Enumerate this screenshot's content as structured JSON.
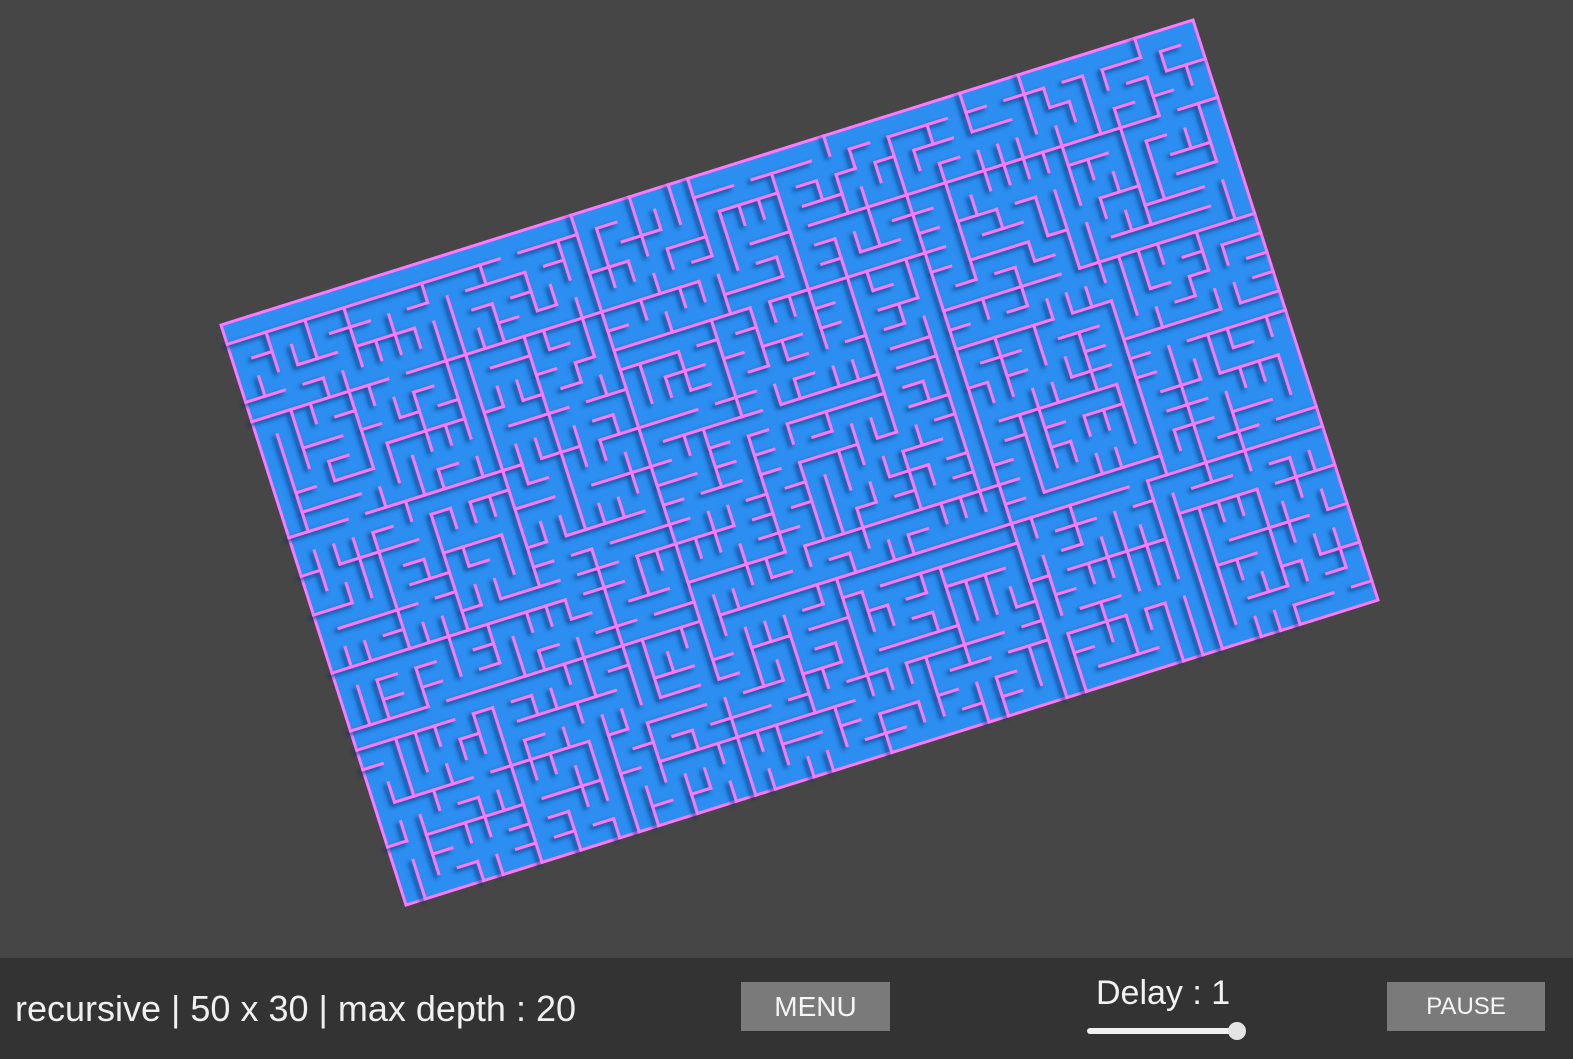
{
  "status": {
    "text": "recursive | 50 x 30 | max depth : 20",
    "algorithm": "recursive",
    "width": 50,
    "height": 30,
    "max_depth": 20
  },
  "controls": {
    "menu_label": "MENU",
    "delay_label": "Delay : 1",
    "delay_value": 1,
    "delay_slider_fraction": 1.0,
    "pause_label": "PAUSE"
  },
  "maze": {
    "colors": {
      "background": "#464646",
      "floor": "#2b8ef0",
      "wall": "#ff78ff",
      "shadow": "#0a2f70"
    }
  }
}
